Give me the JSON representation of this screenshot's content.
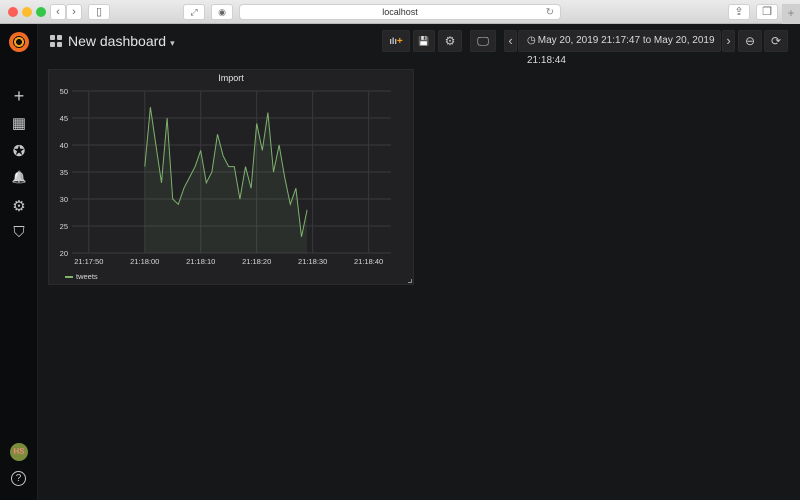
{
  "browser": {
    "url": "localhost",
    "icons": [
      "back-icon",
      "forward-icon",
      "sidebar-icon",
      "fullscreen-icon",
      "privacy-icon",
      "reload-icon",
      "share-icon",
      "tabs-icon",
      "new-tab-icon"
    ],
    "back_glyph": "‹",
    "forward_glyph": "›",
    "reload_glyph": "↻",
    "share_glyph": "⇪",
    "tabs_glyph": "❐",
    "newtab_glyph": "+",
    "sidebar_glyph": "▯",
    "fullscreen_glyph": "⤢",
    "privacy_glyph": "◉"
  },
  "sidebar": {
    "items": [
      {
        "name": "create",
        "glyph": "+"
      },
      {
        "name": "dashboards",
        "glyph": "▦"
      },
      {
        "name": "explore",
        "glyph": "✪"
      },
      {
        "name": "alerting",
        "glyph": "🔔"
      },
      {
        "name": "configuration",
        "glyph": "⚙"
      },
      {
        "name": "server-admin",
        "glyph": "⛉"
      }
    ],
    "avatar_text": "HS",
    "help_glyph": "?"
  },
  "navbar": {
    "dashboard_title": "New dashboard",
    "caret": "▾",
    "add_panel_glyph": "ılı",
    "add_panel_plus": "+",
    "save_glyph": "💾",
    "settings_glyph": "⚙",
    "tv_glyph": "🖵",
    "shift_back_glyph": "‹",
    "time_range": "May 20, 2019 21:17:47 to May 20, 2019 21:18:44",
    "clock_glyph": "◷",
    "shift_forward_glyph": "›",
    "zoom_out_glyph": "⊖",
    "refresh_glyph": "⟳"
  },
  "panel": {
    "title": "Import",
    "legend": "tweets"
  },
  "colors": {
    "series": "#7eb26d",
    "accent": "#f6a019"
  },
  "chart_data": {
    "type": "line",
    "title": "Import",
    "xlabel": "",
    "ylabel": "",
    "ylim": [
      20,
      50
    ],
    "yticks": [
      20,
      25,
      30,
      35,
      40,
      45,
      50
    ],
    "xlim_seconds": [
      -13,
      44
    ],
    "xticks": [
      {
        "label": "21:17:50",
        "t": -10
      },
      {
        "label": "21:18:00",
        "t": 0
      },
      {
        "label": "21:18:10",
        "t": 10
      },
      {
        "label": "21:18:20",
        "t": 20
      },
      {
        "label": "21:18:30",
        "t": 30
      },
      {
        "label": "21:18:40",
        "t": 40
      }
    ],
    "grid": true,
    "fill": true,
    "legend_position": "bottom-left",
    "series": [
      {
        "name": "tweets",
        "t_start": "21:18:00",
        "x": [
          0,
          1,
          2,
          3,
          4,
          5,
          6,
          7,
          8,
          9,
          10,
          11,
          12,
          13,
          14,
          15,
          16,
          17,
          18,
          19,
          20,
          21,
          22,
          23,
          24,
          25,
          26,
          27,
          28,
          29
        ],
        "values": [
          36,
          47,
          40,
          33,
          45,
          30,
          29,
          32,
          34,
          36,
          39,
          33,
          35,
          42,
          38,
          36,
          36,
          30,
          36,
          32,
          44,
          39,
          46,
          35,
          40,
          34,
          29,
          32,
          23,
          28
        ]
      }
    ]
  }
}
